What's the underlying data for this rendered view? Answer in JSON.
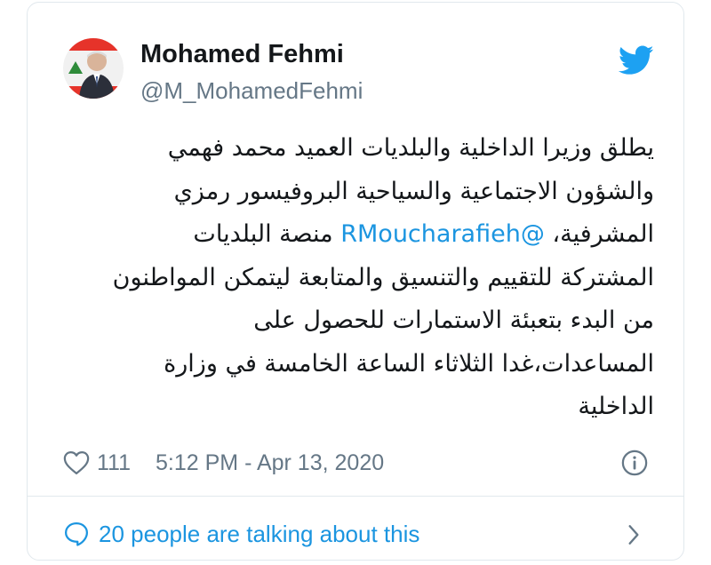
{
  "tweet": {
    "author_name": "Mohamed Fehmi",
    "author_handle": "@M_MohamedFehmi",
    "text_lines": [
      "يطلق وزيرا الداخلية والبلديات العميد محمد فهمي",
      "والشؤون الاجتماعية والسياحية البروفيسور رمزي",
      "المشرفية،",
      "منصة البلديات",
      "المشتركة للتقييم والتنسيق والمتابعة ليتمكن المواطنون",
      "من البدء بتعبئة الاستمارات للحصول على",
      "المساعدات،غدا الثلاثاء الساعة الخامسة في وزارة",
      "الداخلية"
    ],
    "mention": "@RMoucharafieh",
    "like_count": "111",
    "timestamp": "5:12 PM - Apr 13, 2020",
    "talking_text": "20 people are talking about this"
  },
  "icons": {
    "brand": "twitter-bird-icon",
    "like": "heart-icon",
    "info": "info-icon",
    "reply": "speech-bubble-icon",
    "more": "chevron-right-icon"
  },
  "colors": {
    "link": "#1b95e0",
    "text": "#14171a",
    "muted": "#657786",
    "border": "#e1e8ed"
  }
}
